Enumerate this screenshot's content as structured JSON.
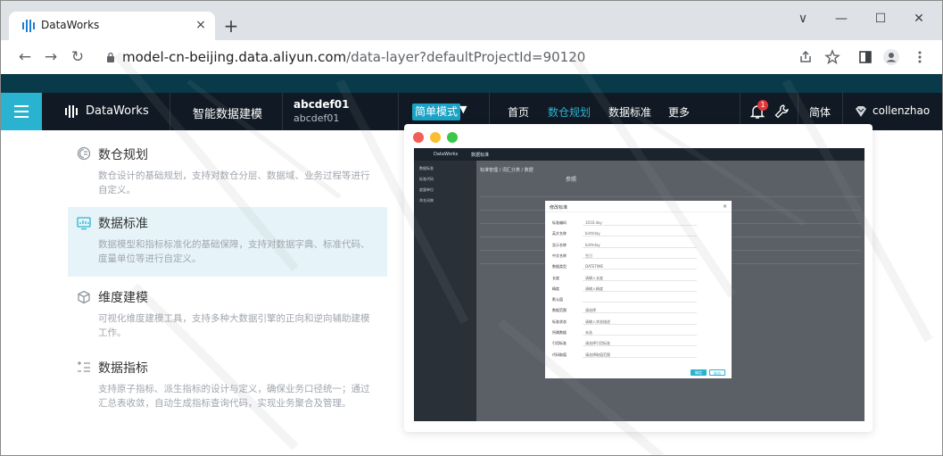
{
  "browser": {
    "tab_title": "DataWorks",
    "tab_close": "×",
    "new_tab": "+",
    "url_host": "model-cn-beijing.data.aliyun.com",
    "url_path": "/data-layer?defaultProjectId=90120",
    "controls": {
      "minimize": "—",
      "maximize": "☐",
      "close": "✕",
      "tab_search": "∨"
    },
    "nav": {
      "back": "←",
      "forward": "→",
      "reload": "↻"
    }
  },
  "header": {
    "brand": "DataWorks",
    "product": "智能数据建模",
    "workspace_name": "abcdef01",
    "workspace_id": "abcdef01",
    "mode": "简单模式",
    "nav": [
      {
        "label": "首页",
        "active": false
      },
      {
        "label": "数仓规划",
        "active": true
      },
      {
        "label": "数据标准",
        "active": false
      },
      {
        "label": "更多",
        "active": false
      }
    ],
    "notification_count": "1",
    "language": "简体",
    "user": "collenzhao"
  },
  "features": [
    {
      "title": "数仓规划",
      "desc": "数仓设计的基础规划，支持对数仓分层、数据域、业务过程等进行自定义。",
      "selected": false
    },
    {
      "title": "数据标准",
      "desc": "数据模型和指标标准化的基础保障，支持对数据字典、标准代码、度量单位等进行自定义。",
      "selected": true
    },
    {
      "title": "维度建模",
      "desc": "可视化维度建模工具，支持多种大数据引擎的正向和逆向辅助建模工作。",
      "selected": false
    },
    {
      "title": "数据指标",
      "desc": "支持原子指标、派生指标的设计与定义，确保业务口径统一；通过汇总表收敛，自动生成指标查询代码，实现业务聚合及管理。",
      "selected": false
    }
  ],
  "preview": {
    "topbar_brand": "DataWorks",
    "topbar_tab": "数据标准",
    "sidebar": [
      "数据标准",
      "标准代码",
      "度量单位",
      "命名词典"
    ],
    "breadcrumb": "标准管理 / 词汇分类 / 数据",
    "section_title": "参照",
    "dialog_title": "修改标准",
    "dialog_close": "×",
    "fields": [
      {
        "label": "标准编码",
        "value": "1010.day"
      },
      {
        "label": "英文名称",
        "value": "birthday"
      },
      {
        "label": "显示名称",
        "value": "birthday"
      },
      {
        "label": "中文名称",
        "value": "生日"
      },
      {
        "label": "数据类型",
        "value": "DATETIME"
      },
      {
        "label": "长度",
        "value": "请输入长度"
      },
      {
        "label": "精度",
        "value": "请输入精度"
      },
      {
        "label": "默认值",
        "value": ""
      },
      {
        "label": "数据范围",
        "value": "请选择"
      },
      {
        "label": "标准状态",
        "value": "请输入状态描述"
      },
      {
        "label": "所属数据",
        "value": "未选"
      },
      {
        "label": "引用标准",
        "value": "请选择引用标准"
      },
      {
        "label": "代码取值",
        "value": "请选择取值范围"
      }
    ],
    "ok": "确定",
    "cancel": "取消"
  },
  "colors": {
    "accent": "#2ab3d1",
    "header_bg": "#111a24",
    "selected_bg": "#e6f4f9"
  }
}
